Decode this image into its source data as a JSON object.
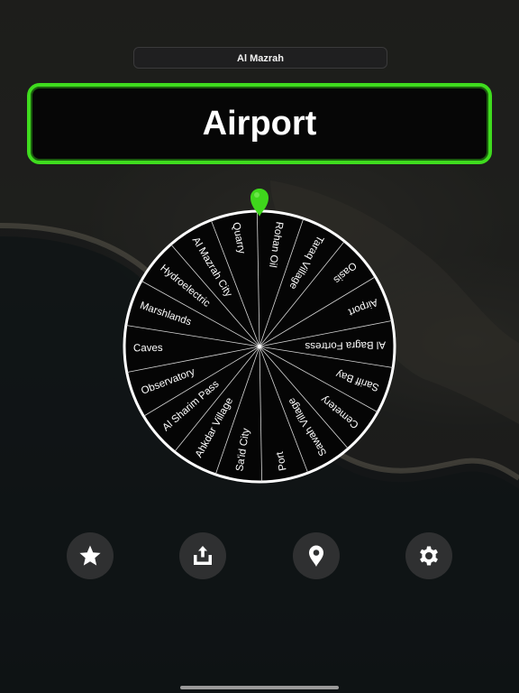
{
  "header": {
    "map_name": "Al Mazrah"
  },
  "result": {
    "text": "Airport"
  },
  "wheel": {
    "segments": [
      "Rohan Oil",
      "Taraq Village",
      "Oasis",
      "Airport",
      "Al Bagra Fortress",
      "Sariff Bay",
      "Cemetery",
      "Sawah Village",
      "Port",
      "Sa'id City",
      "Ahkdar Village",
      "Al Sharim Pass",
      "Observatory",
      "Caves",
      "Marshlands",
      "Hydroelectric",
      "Al Mazrah City",
      "Quarry"
    ],
    "colors": {
      "fill": "#050505",
      "border": "#ffffff",
      "divider": "#d8d8d8",
      "pointer": "#3fd61c"
    }
  },
  "toolbar": {
    "buttons": [
      {
        "icon": "star-icon"
      },
      {
        "icon": "share-icon"
      },
      {
        "icon": "location-pin-icon"
      },
      {
        "icon": "gear-icon"
      }
    ]
  },
  "colors": {
    "accent": "#3fdc1e",
    "button_bg": "#2f3031"
  }
}
